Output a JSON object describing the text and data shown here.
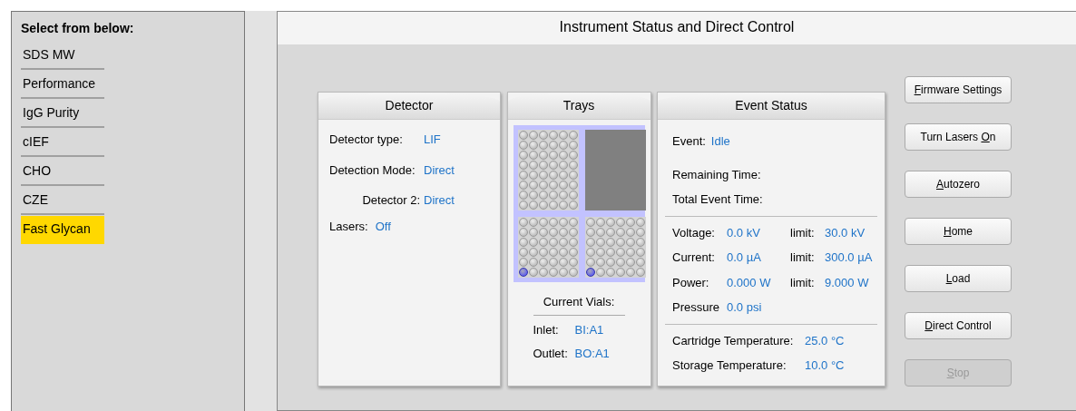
{
  "sidebar": {
    "heading": "Select from below:",
    "items": [
      {
        "label": "SDS MW",
        "selected": false
      },
      {
        "label": "Performance",
        "selected": false
      },
      {
        "label": "IgG Purity",
        "selected": false
      },
      {
        "label": "cIEF",
        "selected": false
      },
      {
        "label": "CHO",
        "selected": false
      },
      {
        "label": "CZE",
        "selected": false
      },
      {
        "label": "Fast Glycan",
        "selected": true
      }
    ]
  },
  "main": {
    "title": "Instrument Status and Direct Control",
    "detector": {
      "title": "Detector",
      "fields": [
        {
          "kind": "column",
          "label": "Detector type:",
          "value": "LIF"
        },
        {
          "kind": "column",
          "label": "Detection Mode:",
          "value": "Direct"
        },
        {
          "kind": "indented",
          "label": "Detector 2:",
          "value": "Direct"
        },
        {
          "kind": "inline",
          "label": "Lasers:",
          "value": "Off"
        }
      ]
    },
    "trays": {
      "title": "Trays",
      "racks": [
        {
          "kind": "large",
          "highlighted": false
        },
        {
          "kind": "empty"
        },
        {
          "kind": "small",
          "highlighted": true
        },
        {
          "kind": "small",
          "highlighted": true
        }
      ],
      "current_vials": {
        "title": "Current Vials:",
        "items": [
          {
            "label": "Inlet:",
            "value": "BI:A1"
          },
          {
            "label": "Outlet:",
            "value": "BO:A1"
          }
        ]
      }
    },
    "event_status": {
      "title": "Event Status",
      "event": {
        "label": "Event:",
        "value": "Idle"
      },
      "times": [
        {
          "label": "Remaining Time:"
        },
        {
          "label": "Total Event Time:"
        }
      ],
      "readings": [
        {
          "label": "Voltage:",
          "value": "0.0 kV",
          "limit_label": "limit:",
          "limit_value": "30.0 kV"
        },
        {
          "label": "Current:",
          "value": "0.0 µA",
          "limit_label": "limit:",
          "limit_value": "300.0 µA"
        },
        {
          "label": "Power:",
          "value": "0.000 W",
          "limit_label": "limit:",
          "limit_value": "9.000 W"
        },
        {
          "label": "Pressure",
          "value": "0.0 psi"
        }
      ],
      "temperatures": [
        {
          "label": "Cartridge Temperature:",
          "value": "25.0 °C"
        },
        {
          "label": "Storage Temperature:",
          "value": "10.0 °C"
        }
      ]
    },
    "buttons": [
      {
        "accelerator": "F",
        "label_end": "irmware Settings",
        "disabled": false
      },
      {
        "label_start": "Turn Lasers ",
        "accelerator": "O",
        "label_end": "n",
        "disabled": false
      },
      {
        "accelerator": "A",
        "label_end": "utozero",
        "disabled": false
      },
      {
        "accelerator": "H",
        "label_end": "ome",
        "disabled": false
      },
      {
        "accelerator": "L",
        "label_end": "oad",
        "disabled": false
      },
      {
        "accelerator": "D",
        "label_end": "irect Control",
        "disabled": false
      },
      {
        "accelerator": "S",
        "label_end": "top",
        "disabled": true
      }
    ]
  }
}
